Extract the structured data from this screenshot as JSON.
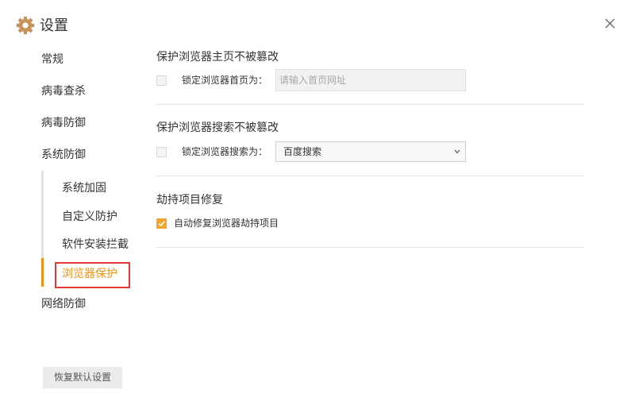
{
  "window": {
    "title": "设置",
    "icon": "gear-icon",
    "close_icon": "close-icon"
  },
  "colors": {
    "accent": "#f39212",
    "checkbox_checked": "#f5a52b",
    "highlight_box": "#e53935",
    "icon": "#c8935a",
    "text": "#333333"
  },
  "sidebar": {
    "items": [
      {
        "label": "常规"
      },
      {
        "label": "病毒查杀"
      },
      {
        "label": "病毒防御"
      },
      {
        "label": "系统防御",
        "children": [
          {
            "label": "系统加固"
          },
          {
            "label": "自定义防护"
          },
          {
            "label": "软件安装拦截"
          },
          {
            "label": "浏览器保护",
            "active": true
          }
        ]
      },
      {
        "label": "网络防御"
      }
    ],
    "reset_button": {
      "label": "恢复默认设置"
    }
  },
  "main": {
    "sections": [
      {
        "title": "保护浏览器主页不被篡改",
        "option": {
          "label": "锁定浏览器首页为：",
          "checked": false
        },
        "input": {
          "value": "",
          "placeholder": "请输入首页网址"
        }
      },
      {
        "title": "保护浏览器搜索不被篡改",
        "option": {
          "label": "锁定浏览器搜索为：",
          "checked": false
        },
        "select": {
          "value": "百度搜索",
          "icon": "chevron-down-icon"
        }
      },
      {
        "title": "劫持项目修复",
        "option": {
          "label": "自动修复浏览器劫持项目",
          "checked": true,
          "icon": "check-icon"
        }
      }
    ]
  }
}
